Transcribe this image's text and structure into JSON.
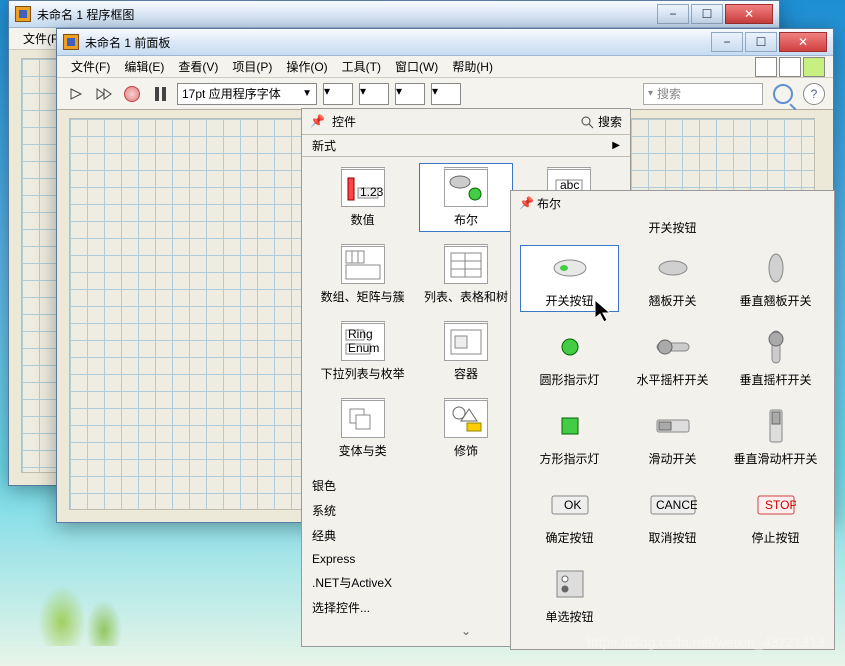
{
  "back_window": {
    "title": "未命名 1 程序框图"
  },
  "front_window": {
    "title": "未命名 1 前面板"
  },
  "menus": {
    "file": "文件(F)",
    "edit": "编辑(E)",
    "view": "查看(V)",
    "project": "项目(P)",
    "operate": "操作(O)",
    "tools": "工具(T)",
    "window": "窗口(W)",
    "help": "帮助(H)"
  },
  "toolbar": {
    "font": "17pt 应用程序字体",
    "search_placeholder": "搜索",
    "question": "?"
  },
  "palette": {
    "title": "控件",
    "search": "搜索",
    "modern": "新式",
    "items": [
      {
        "label": "数值"
      },
      {
        "label": "布尔"
      },
      {
        "label": ""
      },
      {
        "label": "数组、矩阵与簇"
      },
      {
        "label": "列表、表格和树"
      },
      {
        "label": ""
      },
      {
        "label": "下拉列表与枚举"
      },
      {
        "label": "容器"
      },
      {
        "label": ""
      },
      {
        "label": "变体与类"
      },
      {
        "label": "修饰"
      },
      {
        "label": ""
      }
    ],
    "list": [
      "银色",
      "系统",
      "经典",
      "Express",
      ".NET与ActiveX",
      "选择控件..."
    ]
  },
  "submenu": {
    "title": "布尔",
    "section": "开关按钮",
    "items": [
      "开关按钮",
      "翘板开关",
      "垂直翘板开关",
      "圆形指示灯",
      "水平摇杆开关",
      "垂直摇杆开关",
      "方形指示灯",
      "滑动开关",
      "垂直滑动杆开关",
      "确定按钮",
      "取消按钮",
      "停止按钮",
      "单选按钮"
    ],
    "btn_ok": "OK",
    "btn_cancel": "CANCEL",
    "btn_stop": "STOP"
  },
  "watermark": "https://blog.csdn.net/weixin_43221313"
}
